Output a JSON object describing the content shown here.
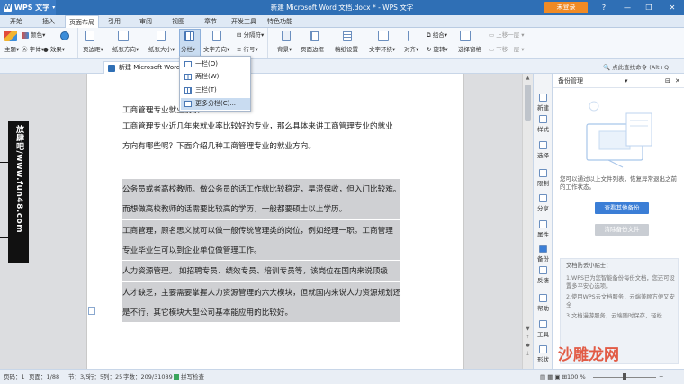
{
  "titlebar": {
    "app_menu_label": "WPS 文字",
    "app_logo_letter": "W",
    "doc_title": "新建 Microsoft Word 文档.docx * - WPS 文字",
    "login_label": "未登录",
    "help_icon": "?",
    "minimize_icon": "—",
    "maximize_icon": "❐",
    "close_icon": "✕"
  },
  "tabs": [
    {
      "label": "开始"
    },
    {
      "label": "插入"
    },
    {
      "label": "页面布局"
    },
    {
      "label": "引用"
    },
    {
      "label": "审阅"
    },
    {
      "label": "视图"
    },
    {
      "label": "章节"
    },
    {
      "label": "开发工具"
    },
    {
      "label": "特色功能"
    }
  ],
  "ribbon": {
    "theme": "主题",
    "colors": "颜色",
    "fonts": "字体",
    "effects": "效果",
    "margins": "页边距",
    "orientation": "纸张方向",
    "size": "纸张大小",
    "columns": "分栏",
    "text_direction": "文字方向",
    "breaks": "分隔符",
    "line_numbers": "行号",
    "background": "背景",
    "page_border": "页面边框",
    "manuscript": "稿纸设置",
    "text_wrap": "文字环绕",
    "align": "对齐",
    "rotate": "旋转",
    "group": "组合",
    "bring_forward": "上移一层",
    "send_backward": "下移一层",
    "selection_pane": "选择窗格"
  },
  "doctab": {
    "label": "新建 Microsoft Word 文档.docx",
    "search_label": "点此查找命令 (Alt+Q"
  },
  "dropdown": {
    "items": [
      {
        "label": "一栏(O)"
      },
      {
        "label": "两栏(W)"
      },
      {
        "label": "三栏(T)"
      },
      {
        "label": "更多分栏(C)..."
      }
    ]
  },
  "document": {
    "lines": [
      "工商管理专业就业前景",
      "工商管理专业近几年来就业率比较好的专业，那么具体来讲工商管理专业的就业",
      "方向有哪些呢？下面介绍几种工商管理专业的就业方向。",
      "公务员或者高校教师。做公务员的话工作就比较稳定，旱涝保收，但入门比较难。",
      "而想做高校教师的话需要比较高的学历，一般都要硕士以上学历。",
      "工商管理，顾名思义就可以做一般传统管理类的岗位，例如经理一职。工商管理",
      "专业毕业生可以到企业单位做管理工作。",
      "人力资源管理。  如招聘专员、绩效专员、培训专员等，该岗位在国内来说顶级",
      "人才缺乏，主要需要掌握人力资源管理的六大模块，但就国内来说人力资源规划还",
      "是不行，其它模块大型公司基本能应用的比较好。"
    ]
  },
  "sidebar": {
    "items": [
      {
        "label": "新建"
      },
      {
        "label": "样式"
      },
      {
        "label": "选择"
      },
      {
        "label": "限制"
      },
      {
        "label": "分享"
      },
      {
        "label": "属性"
      },
      {
        "label": "备份"
      },
      {
        "label": "反馈"
      },
      {
        "label": "帮助"
      },
      {
        "label": "工具"
      },
      {
        "label": "形状"
      }
    ]
  },
  "panel": {
    "title": "备份管理",
    "description": "您可以通过以上文件列表，恢复异常退出之前的工作状态。",
    "view_backup": "查看其他备份",
    "clear_backup": "清除备份文件",
    "tips_title": "文档防丢小贴士：",
    "tips": [
      "1.WPS已为您智能备份每份文档，您还可设置多平安心选项。",
      "2.使用WPS云文档服务，云端兼顾方便又安全",
      "3.文档漫游服务，云端随时保存，轻松..."
    ]
  },
  "statusbar": {
    "page": "页码：1",
    "pages": "页面：1/88",
    "section": "节：3/5",
    "row": "行：5",
    "col": "列：25",
    "wordcount": "字数：209/31089",
    "spellcheck": "拼写检查",
    "zoom": "100 %"
  },
  "banner": {
    "text": "放肆吧/www.fun48.com"
  },
  "watermark": {
    "text": "沙雕龙网"
  }
}
